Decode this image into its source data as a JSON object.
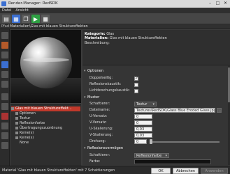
{
  "window": {
    "title": "Render-Manager: RedSDK"
  },
  "menu": [
    "Datei",
    "Ansicht"
  ],
  "path": {
    "prefix": "Pfad",
    "value": "Materialien\\Glas mit blauen Strukturеffekten"
  },
  "info": {
    "category_label": "Kategorie:",
    "category_value": "Glas",
    "materials_label": "Materialien:",
    "materials_value": "Glas mit blauen Strukturеffekten",
    "description_label": "Beschreibung:"
  },
  "tree": {
    "root": "Glas mit blauen Strukturеffekt...",
    "items": [
      "Optionen",
      "Textur",
      "Reflexionfarbe",
      "Übertragungszuordnung",
      "Keine(s)",
      "Keine(s)",
      "None"
    ]
  },
  "props": {
    "options": {
      "title": "Optionen",
      "double_sided_label": "Doppelseitig:",
      "double_sided": true,
      "refl_caustic_label": "Reflexionskaustik:",
      "refl_caustic": false,
      "light_caustic_label": "Lichtbrechungskaustik:",
      "light_caustic": false
    },
    "pattern": {
      "title": "Muster",
      "shader_label": "Schattierer:",
      "shader_value": "Textur",
      "filename_label": "Dateiname:",
      "filename_value": "Textures\\RedSDK\\Glass Blue Eroded Glass.jpg",
      "u_offset_label": "U-Versatz:",
      "u_offset_value": "0",
      "v_offset_label": "V-Versatz:",
      "v_offset_value": "0",
      "u_scale_label": "U-Skalierung:",
      "u_scale_value": "0,03",
      "v_scale_label": "V-Skalierung:",
      "v_scale_value": "0,03",
      "rotation_label": "Drehung:",
      "rotation_value": "0",
      "rotation_fraction": 0.0
    },
    "reflection": {
      "title": "Reflexionsvermögen",
      "shader_label": "Schattierer:",
      "shader_value": "Reflexionfarbe",
      "color_label": "Farbe:"
    }
  },
  "status": {
    "text": "Material 'Glas mit blauen Strukturеffekten' mit 7 Schattierungen"
  },
  "buttons": {
    "ok": "OK",
    "cancel": "Abbrechen",
    "apply": "Anwenden"
  },
  "colors": {
    "selection": "#c0392b",
    "accent_blue": "#3b6fd1",
    "play_green": "#2ea043"
  },
  "icons": [
    "app-icon",
    "new-icon",
    "save-icon",
    "copy-icon",
    "play-icon",
    "stop-icon",
    "expand-icon",
    "collapse-icon"
  ]
}
